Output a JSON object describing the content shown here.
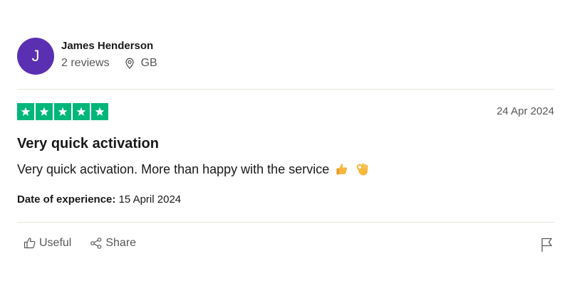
{
  "reviewer": {
    "initial": "J",
    "name": "James Henderson",
    "reviews_count": "2 reviews",
    "country": "GB",
    "avatar_color": "#5b2fb2"
  },
  "review": {
    "rating": 5,
    "max_rating": 5,
    "star_color": "#00b67a",
    "date": "24 Apr 2024",
    "title": "Very quick activation",
    "body": "Very quick activation. More than happy with the service",
    "emojis": [
      "thumbs-up-icon",
      "ok-hand-icon"
    ],
    "experience_label": "Date of experience:",
    "experience_date": "15 April 2024"
  },
  "actions": {
    "useful_label": "Useful",
    "share_label": "Share",
    "icons": [
      "thumbs-up-outline-icon",
      "share-icon",
      "flag-icon"
    ]
  }
}
